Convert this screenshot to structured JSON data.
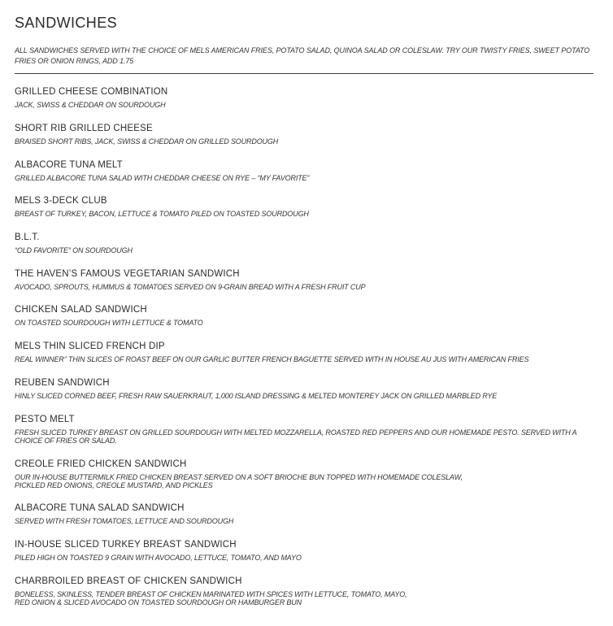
{
  "menu": {
    "section_title": "SANDWICHES",
    "intro": "ALL SANDWICHES SERVED WITH THE CHOICE OF MELS AMERICAN FRIES, POTATO SALAD, QUINOA SALAD OR COLESLAW. TRY OUR TWISTY FRIES, SWEET POTATO FRIES OR ONION RINGS, ADD 1.75",
    "items": [
      {
        "name": "GRILLED CHEESE COMBINATION",
        "description": "JACK, SWISS & CHEDDAR ON SOURDOUGH"
      },
      {
        "name": "SHORT RIB GRILLED CHEESE",
        "description": "BRAISED SHORT RIBS, JACK, SWISS & CHEDDAR ON GRILLED SOURDOUGH"
      },
      {
        "name": "ALBACORE TUNA MELT",
        "description": "GRILLED ALBACORE TUNA SALAD WITH CHEDDAR CHEESE ON RYE – “MY FAVORITE”"
      },
      {
        "name": "MELS 3-DECK CLUB",
        "description": "BREAST OF TURKEY, BACON, LETTUCE & TOMATO PILED ON TOASTED SOURDOUGH"
      },
      {
        "name": "B.L.T.",
        "description": "“OLD FAVORITE” ON SOURDOUGH"
      },
      {
        "name": "THE HAVEN’S FAMOUS VEGETARIAN SANDWICH",
        "description": "AVOCADO, SPROUTS, HUMMUS & TOMATOES SERVED ON 9-GRAIN BREAD WITH A FRESH FRUIT CUP"
      },
      {
        "name": "CHICKEN SALAD SANDWICH",
        "description": "ON TOASTED SOURDOUGH WITH LETTUCE & TOMATO"
      },
      {
        "name": "MELS THIN SLICED FRENCH DIP",
        "description": "REAL WINNER” THIN SLICES OF ROAST BEEF ON OUR GARLIC BUTTER FRENCH BAGUETTE SERVED WITH IN HOUSE AU JUS WITH AMERICAN FRIES"
      },
      {
        "name": "REUBEN SANDWICH",
        "description": "HINLY SLICED CORNED BEEF, FRESH RAW SAUERKRAUT, 1,000 ISLAND DRESSING & MELTED MONTEREY JACK ON GRILLED MARBLED RYE"
      },
      {
        "name": "PESTO MELT",
        "description": "FRESH SLICED TURKEY BREAST ON GRILLED SOURDOUGH WITH MELTED MOZZARELLA, ROASTED RED PEPPERS AND OUR HOMEMADE PESTO. SERVED WITH A CHOICE OF FRIES OR SALAD."
      },
      {
        "name": "CREOLE FRIED CHICKEN SANDWICH",
        "description": "OUR IN-HOUSE BUTTERMILK FRIED CHICKEN BREAST SERVED ON A SOFT BRIOCHE BUN TOPPED WITH HOMEMADE COLESLAW,\nPICKLED RED ONIONS, CREOLE MUSTARD, AND PICKLES"
      },
      {
        "name": "ALBACORE TUNA SALAD SANDWICH",
        "description": "SERVED WITH FRESH TOMATOES, LETTUCE AND SOURDOUGH"
      },
      {
        "name": "IN-HOUSE SLICED TURKEY BREAST SANDWICH",
        "description": "PILED HIGH ON TOASTED 9 GRAIN WITH AVOCADO, LETTUCE, TOMATO, AND MAYO"
      },
      {
        "name": "CHARBROILED BREAST OF CHICKEN SANDWICH",
        "description": "BONELESS, SKINLESS, TENDER BREAST OF CHICKEN MARINATED WITH SPICES WITH LETTUCE, TOMATO, MAYO,\nRED ONION & SLICED AVOCADO ON TOASTED SOURDOUGH OR HAMBURGER BUN"
      }
    ]
  },
  "colors": {
    "divider": "#2f4a4a",
    "text": "#2b2b2b"
  }
}
